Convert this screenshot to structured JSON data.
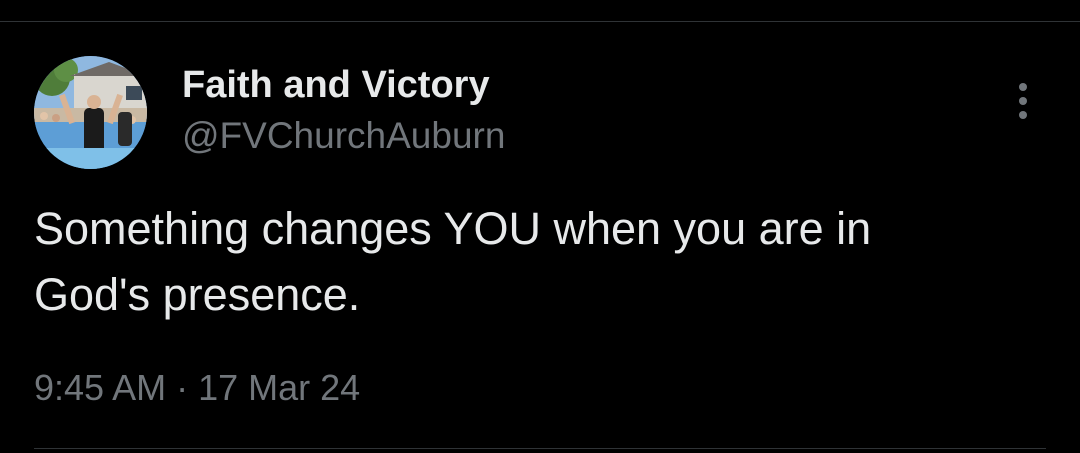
{
  "tweet": {
    "author": {
      "name": "Faith and Victory",
      "handle": "@FVChurchAuburn",
      "avatar_icon": "profile-photo"
    },
    "text_line1": "Something changes YOU when you are in",
    "text_line2": "God's presence.",
    "time": "9:45 AM",
    "separator": " · ",
    "date": "17 Mar 24",
    "more_icon": "more-vertical-icon"
  },
  "colors": {
    "background": "#000000",
    "primary_text": "#e7e9ea",
    "secondary_text": "#71767b",
    "divider": "#2f3336"
  }
}
